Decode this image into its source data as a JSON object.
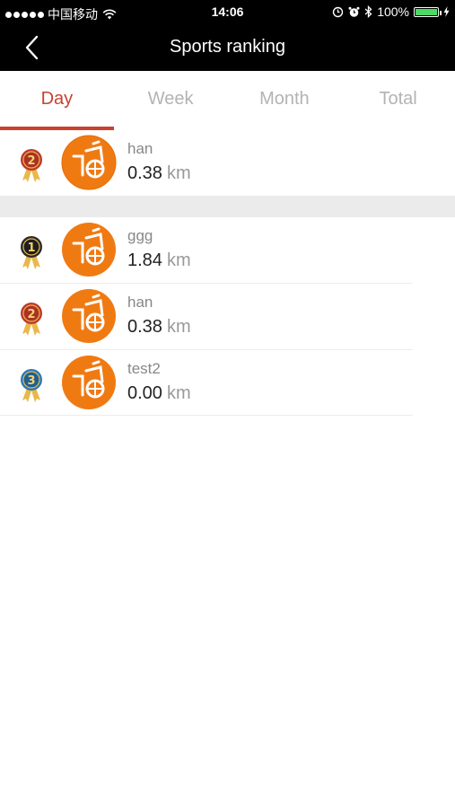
{
  "status_bar": {
    "carrier": "中国移动",
    "time": "14:06",
    "battery": "100%",
    "battery_level": 1.0
  },
  "nav": {
    "title": "Sports ranking",
    "back_icon": "chevron-left-icon"
  },
  "tabs": [
    {
      "label": "Day",
      "active": true
    },
    {
      "label": "Week",
      "active": false
    },
    {
      "label": "Month",
      "active": false
    },
    {
      "label": "Total",
      "active": false
    }
  ],
  "my_rank": {
    "rank": 2,
    "name": "han",
    "distance": "0.38",
    "unit": "km"
  },
  "rankings": [
    {
      "rank": 1,
      "name": "ggg",
      "distance": "1.84",
      "unit": "km"
    },
    {
      "rank": 2,
      "name": "han",
      "distance": "0.38",
      "unit": "km"
    },
    {
      "rank": 3,
      "name": "test2",
      "distance": "0.00",
      "unit": "km"
    }
  ],
  "colors": {
    "accent": "#c9412f",
    "avatar_orange": "#f07a12"
  }
}
